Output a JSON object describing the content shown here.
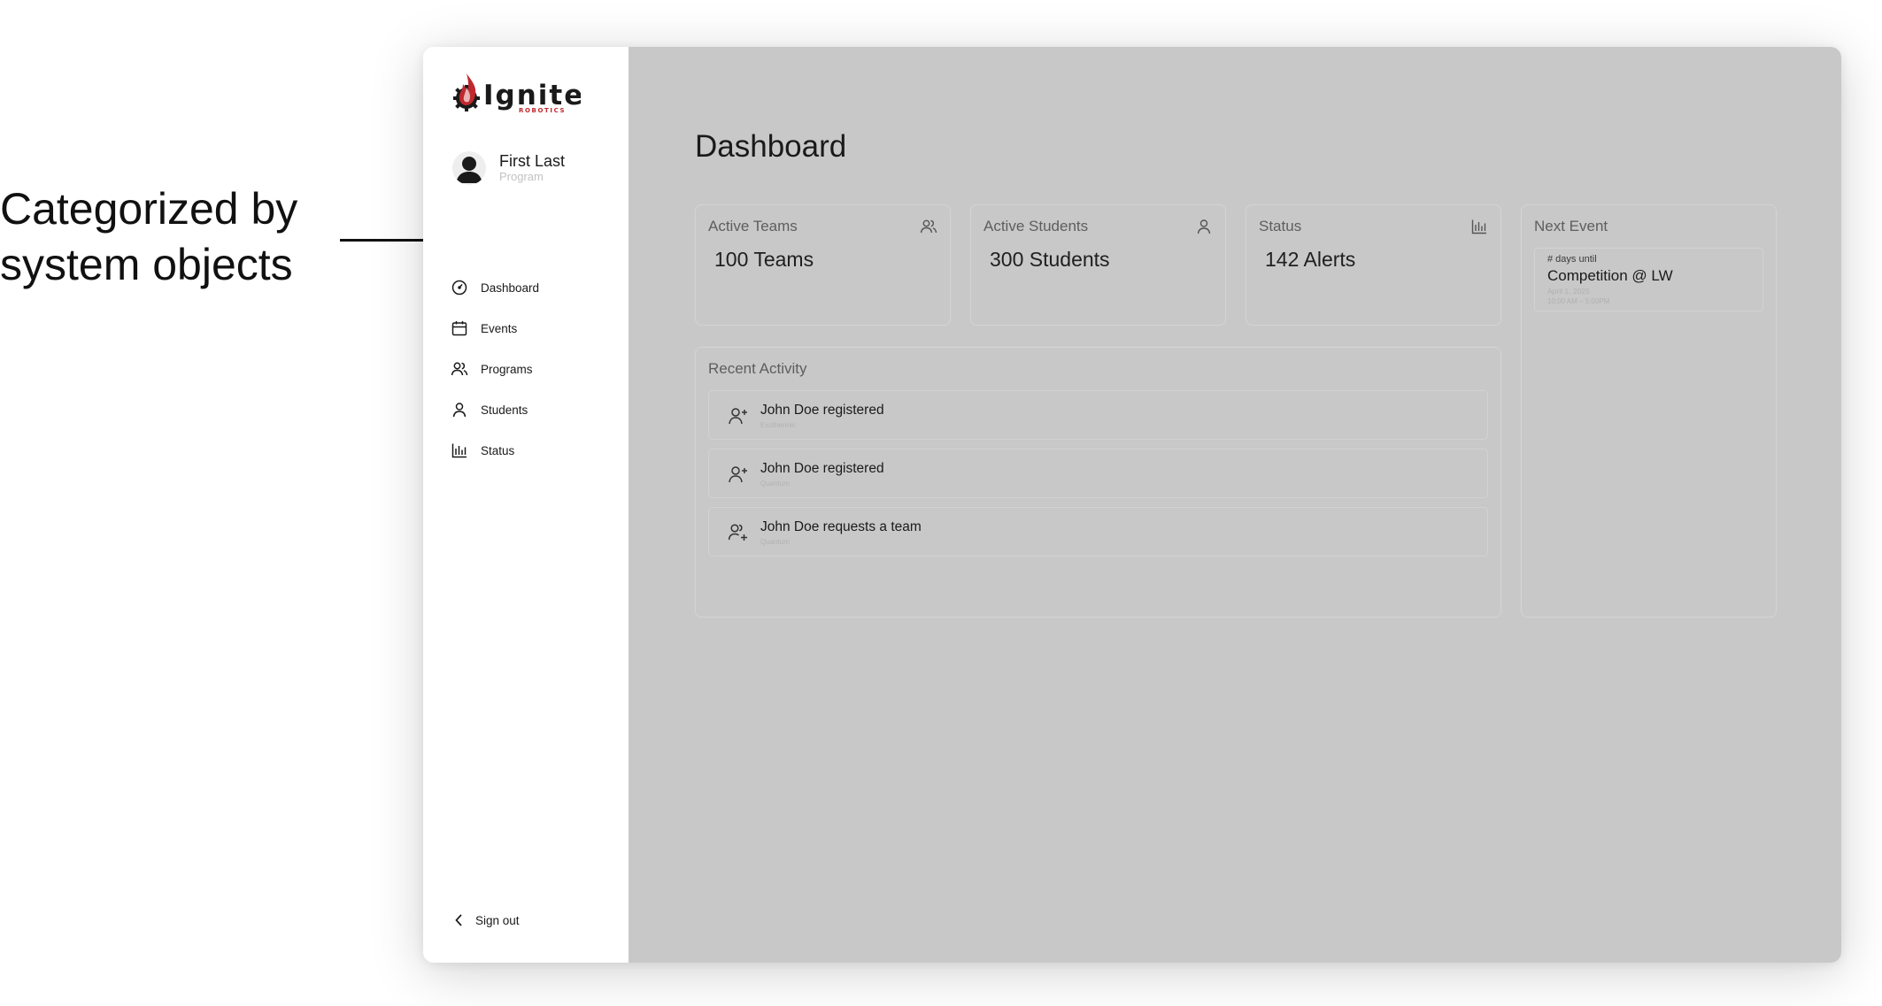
{
  "annotation": {
    "line1": "Categorized by",
    "line2": "system objects"
  },
  "brand": {
    "logo_text": "Ignite",
    "logo_sub": "ROBOTICS",
    "accent_color": "#c0282d"
  },
  "user": {
    "name": "First Last",
    "role": "Program"
  },
  "sidebar": {
    "items": [
      {
        "label": "Dashboard",
        "icon": "gauge-icon"
      },
      {
        "label": "Events",
        "icon": "calendar-icon"
      },
      {
        "label": "Programs",
        "icon": "users-icon"
      },
      {
        "label": "Students",
        "icon": "user-icon"
      },
      {
        "label": "Status",
        "icon": "bar-chart-icon"
      }
    ],
    "signout_label": "Sign out"
  },
  "main": {
    "title": "Dashboard",
    "stats": [
      {
        "title": "Active Teams",
        "value": "100 Teams",
        "icon": "users-icon"
      },
      {
        "title": "Active Students",
        "value": "300 Students",
        "icon": "user-icon"
      },
      {
        "title": "Status",
        "value": "142 Alerts",
        "icon": "bar-chart-icon"
      }
    ],
    "recent_activity": {
      "title": "Recent Activity",
      "items": [
        {
          "text": "John Doe registered",
          "sub": "Exothermic",
          "icon": "user-plus-icon"
        },
        {
          "text": "John Doe registered",
          "sub": "Quantum",
          "icon": "user-plus-icon"
        },
        {
          "text": "John Doe requests a team",
          "sub": "Quantum",
          "icon": "users-plus-icon"
        }
      ]
    },
    "next_event": {
      "title": "Next Event",
      "kicker": "# days until",
      "name": "Competition @ LW",
      "date": "April 1, 2025",
      "time": "10:00 AM – 5:00PM"
    }
  },
  "colors": {
    "main_bg": "#c8c8c8",
    "sidebar_bg": "#ffffff"
  }
}
